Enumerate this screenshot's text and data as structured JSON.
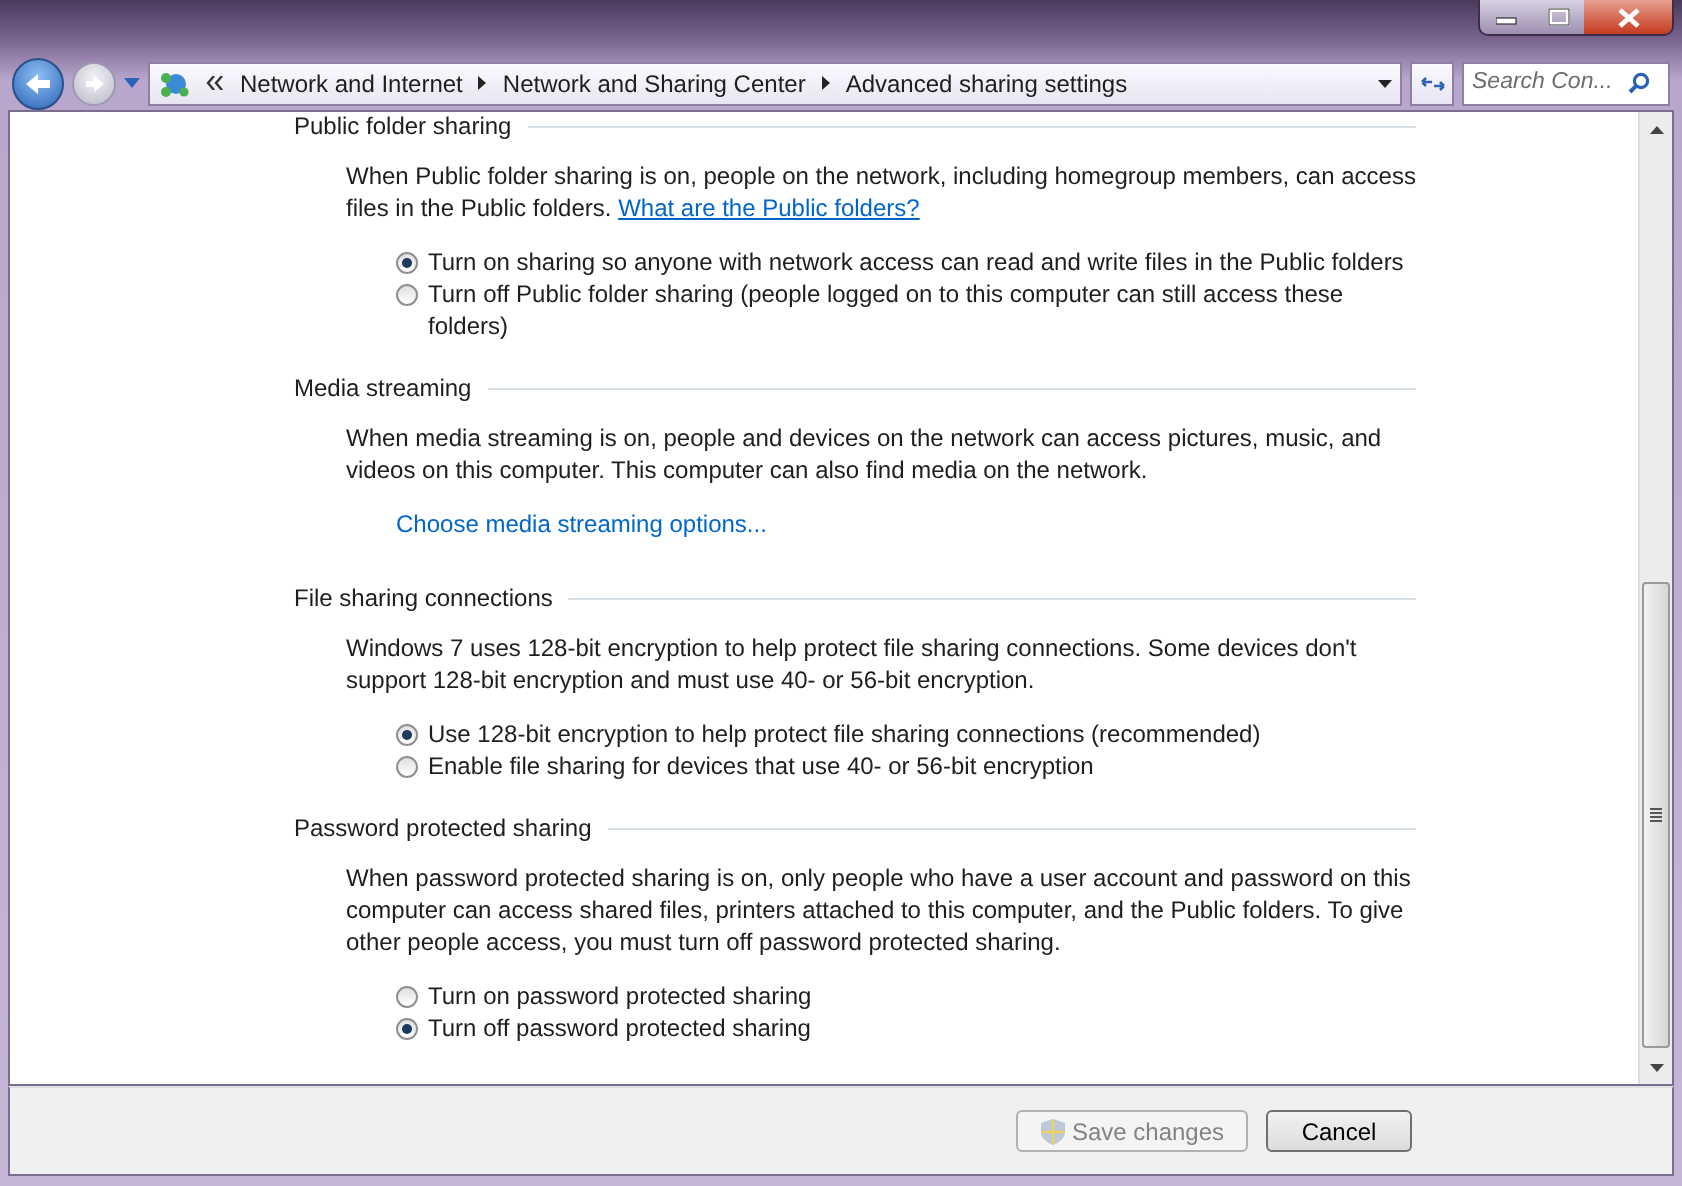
{
  "window": {
    "controls": [
      {
        "kind": "minimize"
      },
      {
        "kind": "maximize"
      },
      {
        "kind": "close"
      }
    ]
  },
  "address_bar": {
    "breadcrumbs": [
      "Network and Internet",
      "Network and Sharing Center",
      "Advanced sharing settings"
    ],
    "search": {
      "placeholder": "Search Con..."
    }
  },
  "sections": [
    {
      "title": "Public folder sharing",
      "description": "When Public folder sharing is on, people on the network, including homegroup members, can access files in the Public folders.",
      "inline_link": "What are the Public folders?",
      "options": [
        {
          "label": "Turn on sharing so anyone with network access can read and write files in the Public folders",
          "selected": true
        },
        {
          "label": "Turn off Public folder sharing (people logged on to this computer can still access these folders)",
          "selected": false
        }
      ]
    },
    {
      "title": "Media streaming",
      "description": "When media streaming is on, people and devices on the network can access pictures, music, and videos on this computer. This computer can also find media on the network.",
      "link": "Choose media streaming options..."
    },
    {
      "title": "File sharing connections",
      "description": "Windows 7 uses 128-bit encryption to help protect file sharing connections. Some devices don't support 128-bit encryption and must use 40- or 56-bit encryption.",
      "options": [
        {
          "label": "Use 128-bit encryption to help protect file sharing connections (recommended)",
          "selected": true
        },
        {
          "label": "Enable file sharing for devices that use 40- or 56-bit encryption",
          "selected": false
        }
      ]
    },
    {
      "title": "Password protected sharing",
      "description": "When password protected sharing is on, only people who have a user account and password on this computer can access shared files, printers attached to this computer, and the Public folders. To give other people access, you must turn off password protected sharing.",
      "options": [
        {
          "label": "Turn on password protected sharing",
          "selected": false
        },
        {
          "label": "Turn off password protected sharing",
          "selected": true
        }
      ]
    }
  ],
  "footer": {
    "buttons": [
      {
        "label": "Save changes",
        "kind": "shield",
        "disabled": true
      },
      {
        "label": "Cancel",
        "kind": "plain",
        "disabled": false
      }
    ]
  }
}
